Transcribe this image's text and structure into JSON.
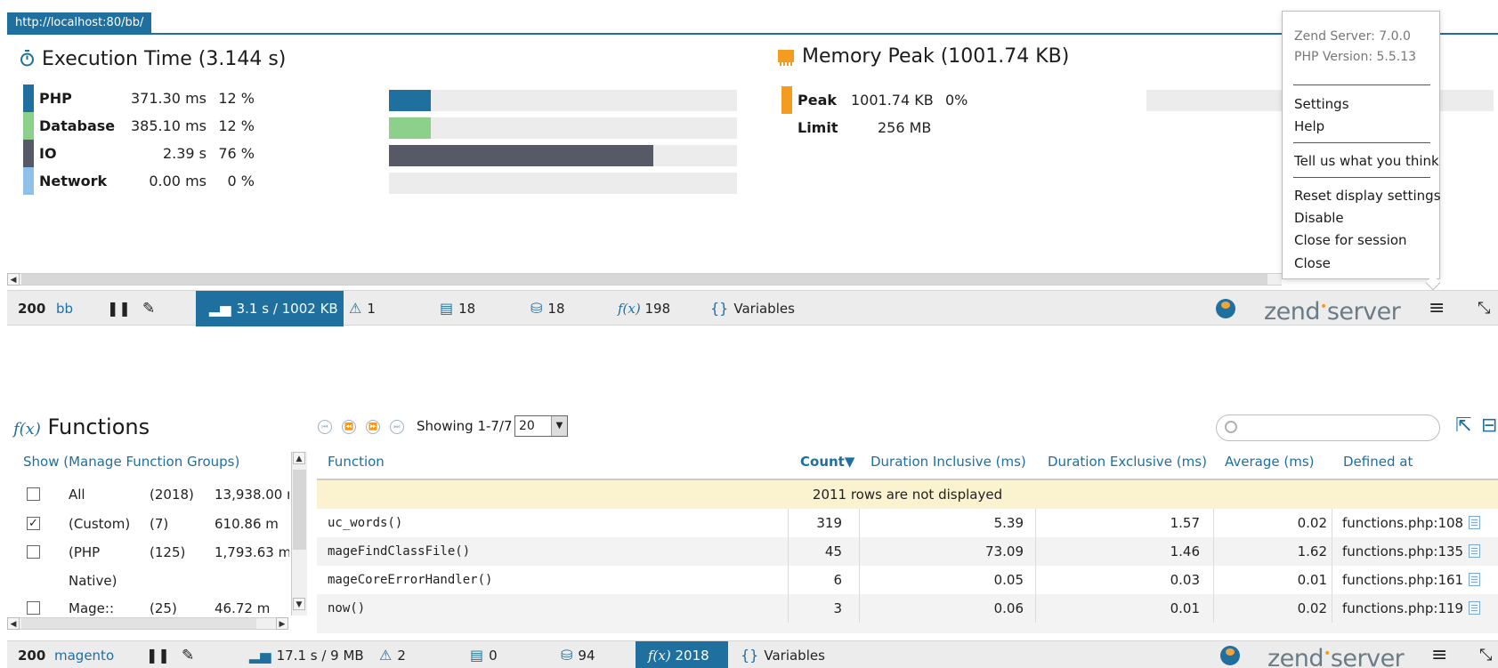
{
  "url_tag": "http://localhost:80/bb/",
  "execution": {
    "title": "Execution Time (3.144 s)",
    "rows": [
      {
        "name": "PHP",
        "value": "371.30 ms",
        "percent": "12 %",
        "color": "#1f6f9f",
        "bar_fraction": 0.12
      },
      {
        "name": "Database",
        "value": "385.10 ms",
        "percent": "12 %",
        "color": "#8dd08b",
        "bar_fraction": 0.12
      },
      {
        "name": "IO",
        "value": "2.39 s",
        "percent": "76 %",
        "color": "#575a66",
        "bar_fraction": 0.76
      },
      {
        "name": "Network",
        "value": "0.00 ms",
        "percent": "0 %",
        "color": "#8fc0ea",
        "bar_fraction": 0.0
      }
    ]
  },
  "memory": {
    "title": "Memory Peak (1001.74 KB)",
    "peak_label": "Peak",
    "peak_value": "1001.74 KB",
    "peak_percent": "0%",
    "limit_label": "Limit",
    "limit_value": "256 MB",
    "color": "#f39c1f"
  },
  "menu": {
    "zend_version": "Zend Server: 7.0.0",
    "php_version": "PHP Version: 5.5.13",
    "settings": "Settings",
    "help": "Help",
    "feedback": "Tell us what you think",
    "reset": "Reset display settings",
    "disable": "Disable",
    "close_session": "Close for session",
    "close": "Close"
  },
  "toolbar_top": {
    "status": "200",
    "app": "bb",
    "pause_icon": "pause-icon",
    "pin_icon": "pin-icon",
    "perf": "3.1 s / 1002 KB",
    "warnings": "1",
    "logs": "18",
    "queries": "18",
    "functions": "198",
    "variables": "Variables",
    "logo_a": "zend",
    "logo_b": "server"
  },
  "functions": {
    "title": "Functions",
    "fx": "f(x)",
    "showing": "Showing 1-7/7",
    "page_size": "20",
    "groups_header": "Show (Manage Function Groups)",
    "groups": [
      {
        "checked": false,
        "name": "All",
        "count": "(2018)",
        "time": "13,938.00 m"
      },
      {
        "checked": true,
        "name": "(Custom)",
        "count": "(7)",
        "time": "610.86 m"
      },
      {
        "checked": false,
        "name": "(PHP",
        "name2": "Native)",
        "count": "(125)",
        "time": "1,793.63 m"
      },
      {
        "checked": false,
        "name": "Mage::",
        "count": "(25)",
        "time": "46.72 m"
      }
    ],
    "columns": {
      "function": "Function",
      "count": "Count▼",
      "dur_incl": "Duration Inclusive (ms)",
      "dur_excl": "Duration Exclusive (ms)",
      "average": "Average (ms)",
      "defined": "Defined at"
    },
    "notice": "2011 rows are not displayed",
    "rows": [
      {
        "fn": "uc_words()",
        "count": "319",
        "incl": "5.39",
        "excl": "1.57",
        "avg": "0.02",
        "defined": "functions.php:108"
      },
      {
        "fn": "mageFindClassFile()",
        "count": "45",
        "incl": "73.09",
        "excl": "1.46",
        "avg": "1.62",
        "defined": "functions.php:135"
      },
      {
        "fn": "mageCoreErrorHandler()",
        "count": "6",
        "incl": "0.05",
        "excl": "0.03",
        "avg": "0.01",
        "defined": "functions.php:161"
      },
      {
        "fn": "now()",
        "count": "3",
        "incl": "0.06",
        "excl": "0.01",
        "avg": "0.02",
        "defined": "functions.php:119"
      }
    ]
  },
  "toolbar_bottom": {
    "status": "200",
    "app": "magento",
    "perf": "17.1 s / 9 MB",
    "warnings": "2",
    "logs": "0",
    "queries": "94",
    "functions": "2018",
    "variables": "Variables",
    "logo_a": "zend",
    "logo_b": "server"
  }
}
